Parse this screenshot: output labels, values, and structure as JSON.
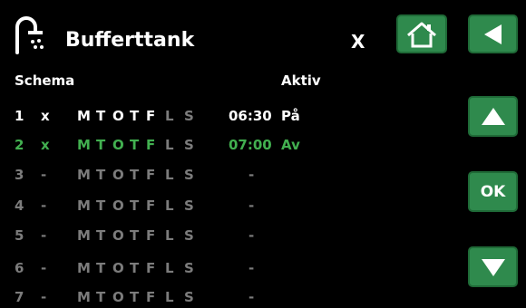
{
  "header": {
    "title": "Bufferttank",
    "close_label": "X"
  },
  "buttons": {
    "ok_label": "OK"
  },
  "columns": {
    "schedule": "Schema",
    "active": "Aktiv"
  },
  "days": [
    "M",
    "T",
    "O",
    "T",
    "F",
    "L",
    "S"
  ],
  "rows": [
    {
      "num": "1",
      "mark": "x",
      "time": "06:30",
      "status": "På"
    },
    {
      "num": "2",
      "mark": "x",
      "time": "07:00",
      "status": "Av"
    },
    {
      "num": "3",
      "mark": "-",
      "time": "-",
      "status": ""
    },
    {
      "num": "4",
      "mark": "-",
      "time": "-",
      "status": ""
    },
    {
      "num": "5",
      "mark": "-",
      "time": "-",
      "status": ""
    },
    {
      "num": "6",
      "mark": "-",
      "time": "-",
      "status": ""
    },
    {
      "num": "7",
      "mark": "-",
      "time": "-",
      "status": ""
    }
  ],
  "colors": {
    "button_green": "#2f8a4d",
    "active_green": "#42b050",
    "inactive_gray": "#7c7c7c"
  }
}
